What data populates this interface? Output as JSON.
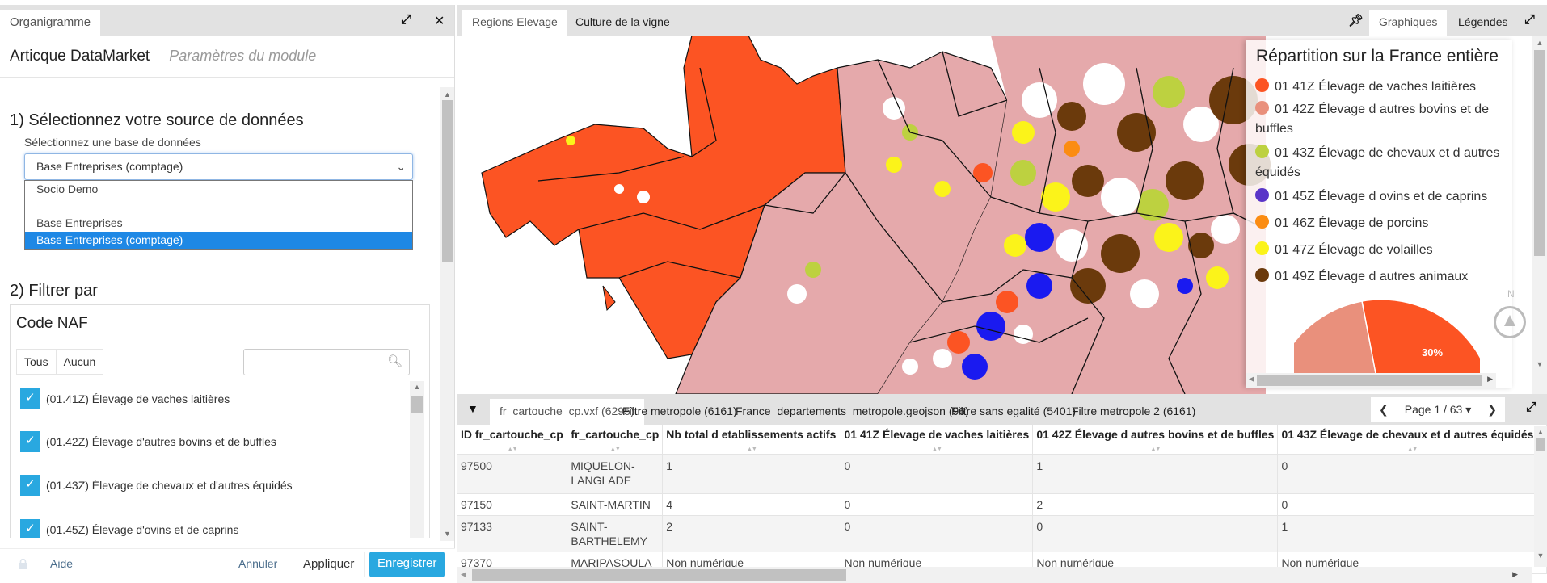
{
  "left_panel": {
    "tab": "Organigramme",
    "module_title": "Articque DataMarket",
    "module_subtitle": "Paramètres du module",
    "section1_title": "1) Sélectionnez votre source de données",
    "db_label": "Sélectionnez une base de données",
    "db_selected": "Base Entreprises (comptage)",
    "db_options": [
      "Socio Demo",
      "",
      "Base Entreprises",
      "Base Entreprises (comptage)"
    ],
    "section2_title": "2) Filtrer par",
    "filter_title": "Code NAF",
    "btn_all": "Tous",
    "btn_none": "Aucun",
    "search_placeholder": "",
    "naf_items": [
      {
        "label": "(01.41Z) Élevage de vaches laitières",
        "checked": true
      },
      {
        "label": "(01.42Z) Élevage d'autres bovins et de buffles",
        "checked": true
      },
      {
        "label": "(01.43Z) Élevage de chevaux et d'autres équidés",
        "checked": true
      },
      {
        "label": "(01.45Z) Élevage d'ovins et de caprins",
        "checked": true
      }
    ],
    "footer": {
      "help": "Aide",
      "cancel": "Annuler",
      "apply": "Appliquer",
      "save": "Enregistrer"
    }
  },
  "map_panel": {
    "tabs": [
      "Regions Elevage",
      "Culture de la vigne"
    ],
    "right_tabs": [
      "Graphiques",
      "Légendes"
    ],
    "legend_title": "Répartition sur la France entière",
    "legend": [
      {
        "label": "01 41Z Élevage de vaches laitières",
        "color": "#fc5423"
      },
      {
        "label": "01 42Z Élevage d autres bovins et de buffles",
        "color": "#e9907c"
      },
      {
        "label": "01 43Z Élevage de chevaux et d autres équidés",
        "color": "#bdd140"
      },
      {
        "label": "01 45Z Élevage d ovins et de caprins",
        "color": "#5a35c8"
      },
      {
        "label": "01 46Z Élevage de porcins",
        "color": "#fb8c12"
      },
      {
        "label": "01 47Z Élevage de volailles",
        "color": "#fbf31a"
      },
      {
        "label": "01 49Z Élevage d autres animaux",
        "color": "#6b3a0c"
      }
    ],
    "pie_label": "30%",
    "compass_label": "N"
  },
  "table_panel": {
    "tabs": [
      "fr_cartouche_cp.vxf (6295)",
      "Filtre metropole (6161)",
      "France_departements_metropole.geojson (96)",
      "Filtre sans egalité (5401)",
      "Filtre metropole 2 (6161)"
    ],
    "page_label": "Page 1 / 63",
    "columns": [
      "ID fr_cartouche_cp",
      "fr_cartouche_cp",
      "Nb total d etablissements actifs",
      "01 41Z Élevage de vaches laitières",
      "01 42Z Élevage d autres bovins et de buffles",
      "01 43Z Élevage de chevaux et d autres équidés"
    ],
    "rows": [
      [
        "97500",
        "MIQUELON-LANGLADE",
        "1",
        "0",
        "1",
        "0"
      ],
      [
        "97150",
        "SAINT-MARTIN",
        "4",
        "0",
        "2",
        "0"
      ],
      [
        "97133",
        "SAINT-BARTHELEMY",
        "2",
        "0",
        "0",
        "1"
      ],
      [
        "97370",
        "MARIPASOULA",
        "Non numérique",
        "Non numérique",
        "Non numérique",
        "Non numérique"
      ]
    ]
  }
}
